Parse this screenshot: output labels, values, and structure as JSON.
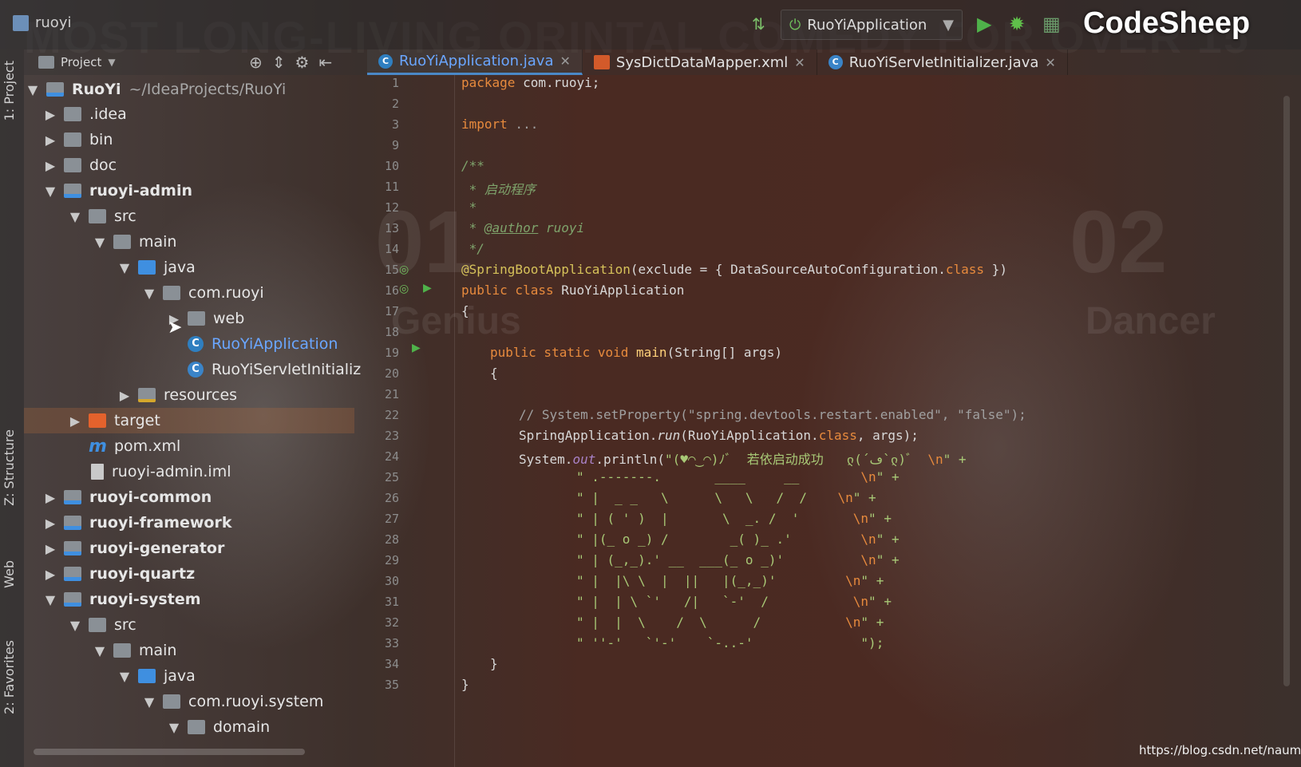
{
  "titlebar": {
    "project_name": "ruoyi",
    "run_config": "RuoYiApplication",
    "brand": "CodeSheep"
  },
  "watermark": {
    "banner": "MOST LONG-LIVING ORINTAL COMEDY FOR OVER 15",
    "num_left": "01",
    "num_right": "02",
    "word_left": "Genius",
    "word_right": "Dancer"
  },
  "side_tabs": {
    "project": "1: Project",
    "structure": "Z: Structure",
    "web": "Web",
    "favorites": "2: Favorites"
  },
  "project_panel": {
    "header": "Project",
    "tree": [
      {
        "label": "RuoYi",
        "suffix": "~/IdeaProjects/RuoYi"
      },
      {
        "label": ".idea"
      },
      {
        "label": "bin"
      },
      {
        "label": "doc"
      },
      {
        "label": "ruoyi-admin"
      },
      {
        "label": "src"
      },
      {
        "label": "main"
      },
      {
        "label": "java"
      },
      {
        "label": "com.ruoyi"
      },
      {
        "label": "web"
      },
      {
        "label": "RuoYiApplication"
      },
      {
        "label": "RuoYiServletInitializ"
      },
      {
        "label": "resources"
      },
      {
        "label": "target"
      },
      {
        "label": "pom.xml"
      },
      {
        "label": "ruoyi-admin.iml"
      },
      {
        "label": "ruoyi-common"
      },
      {
        "label": "ruoyi-framework"
      },
      {
        "label": "ruoyi-generator"
      },
      {
        "label": "ruoyi-quartz"
      },
      {
        "label": "ruoyi-system"
      },
      {
        "label": "src"
      },
      {
        "label": "main"
      },
      {
        "label": "java"
      },
      {
        "label": "com.ruoyi.system"
      },
      {
        "label": "domain"
      }
    ]
  },
  "tabs": [
    {
      "label": "RuoYiApplication.java"
    },
    {
      "label": "SysDictDataMapper.xml"
    },
    {
      "label": "RuoYiServletInitializer.java"
    }
  ],
  "editor": {
    "line_numbers": [
      "1",
      "2",
      "3",
      "9",
      "10",
      "11",
      "12",
      "13",
      "14",
      "15",
      "16",
      "17",
      "18",
      "19",
      "20",
      "21",
      "22",
      "23",
      "24",
      "25",
      "26",
      "27",
      "28",
      "29",
      "30",
      "31",
      "32",
      "33",
      "34",
      "35"
    ],
    "l1_kw": "package",
    "l1_rest": " com.ruoyi;",
    "l3_kw": "import",
    "l3_rest": " ...",
    "l10": "/**",
    "l11": " * 启动程序",
    "l12": " *",
    "l13_a": " * ",
    "l13_tag": "@author",
    "l13_b": " ruoyi",
    "l14": " */",
    "l15_ann": "@SpringBootApplication",
    "l15_a": "(exclude = { DataSourceAutoConfiguration.",
    "l15_kw": "class",
    "l15_b": " })",
    "l16_kw": "public class",
    "l16_rest": " RuoYiApplication",
    "l17": "{",
    "l19_kw": "public static void",
    "l19_fn": " main",
    "l19_rest": "(String[] args)",
    "l20": "{",
    "l22": "// System.setProperty(\"spring.devtools.restart.enabled\", \"false\");",
    "l23_a": "SpringApplication.",
    "l23_run": "run",
    "l23_b": "(RuoYiApplication.",
    "l23_kw": "class",
    "l23_c": ", args);",
    "l24_a": "System.",
    "l24_out": "out",
    "l24_b": ".println(",
    "l24_str": "\"(♥◠‿◠)ﾉﾞ  若依启动成功   ლ(´ڡ`ლ)ﾞ  ",
    "l24_esc": "\\n",
    "l24_end": "\" +",
    "art": [
      "\" .-------.       ____     __        ",
      "\" |  _ _   \\      \\   \\   /  /    ",
      "\" | ( ' )  |       \\  _. /  '       ",
      "\" |(_ o _) /        _( )_ .'         ",
      "\" | (_,_).' __  ___(_ o _)'          ",
      "\" |  |\\ \\  |  ||   |(_,_)'         ",
      "\" |  | \\ `'   /|   `-'  /           ",
      "\" |  |  \\    /  \\      /           ",
      "\" ''-'   `'-'    `-..-'              "
    ],
    "art_tail": "\" +",
    "art_last_tail": "\");",
    "l34": "}",
    "l35": "}"
  },
  "footer": {
    "link": "https://blog.csdn.net/naumy"
  }
}
